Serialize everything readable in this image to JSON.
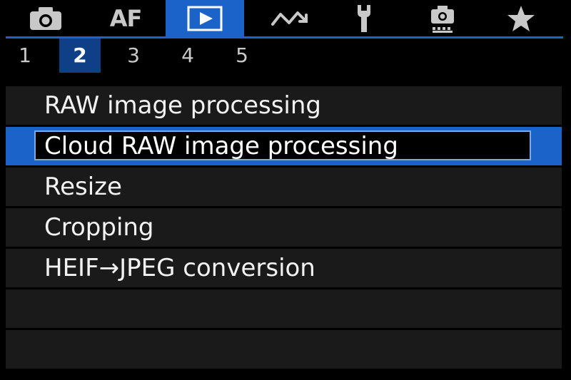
{
  "tabs": [
    {
      "icon": "camera-icon",
      "active": false
    },
    {
      "icon": "af-icon",
      "label": "AF",
      "active": false
    },
    {
      "icon": "playback-icon",
      "active": true
    },
    {
      "icon": "wireless-icon",
      "active": false
    },
    {
      "icon": "wrench-icon",
      "active": false
    },
    {
      "icon": "custom-functions-icon",
      "active": false
    },
    {
      "icon": "star-icon",
      "active": false
    }
  ],
  "pages": [
    "1",
    "2",
    "3",
    "4",
    "5"
  ],
  "active_page": "2",
  "menu": {
    "items": [
      {
        "label": "RAW image processing",
        "selected": false
      },
      {
        "label": "Cloud RAW image processing",
        "selected": true
      },
      {
        "label": "Resize",
        "selected": false
      },
      {
        "label": "Cropping",
        "selected": false
      },
      {
        "label": "HEIF→JPEG conversion",
        "selected": false
      },
      {
        "label": "",
        "selected": false
      },
      {
        "label": "",
        "selected": false
      }
    ]
  },
  "colors": {
    "accent": "#1c63c9",
    "page_active": "#0f3f86",
    "row_bg": "#1a1a1a",
    "background": "#000000"
  }
}
